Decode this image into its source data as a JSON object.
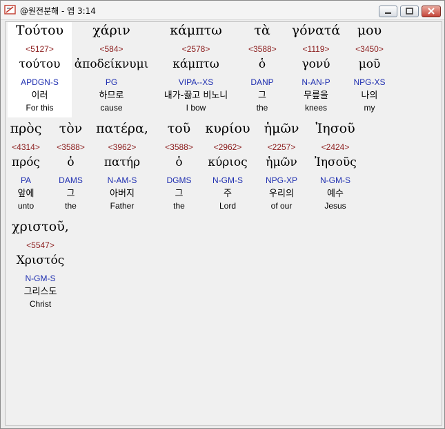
{
  "window": {
    "title": "@원전분해 - 엡 3:14",
    "icon": "bible-app-icon"
  },
  "titlebar_buttons": [
    "minimize",
    "maximize",
    "close"
  ],
  "words": [
    {
      "greek": "Τούτου",
      "strong": "<5127>",
      "lemma": "τούτου",
      "parsing": "APDGN-S",
      "korean": "이러",
      "english": "For this"
    },
    {
      "greek": "χάριν",
      "strong": "<584>",
      "lemma": "ἀποδείκνυμι",
      "parsing": "PG",
      "korean": "하므로",
      "english": "cause"
    },
    {
      "greek": "κάμπτω",
      "strong": "<2578>",
      "lemma": "κάμπτω",
      "parsing": "VIPA--XS",
      "korean": "내가-끓고 비노니",
      "english": "I bow"
    },
    {
      "greek": "τὰ",
      "strong": "<3588>",
      "lemma": "ὁ",
      "parsing": "DANP",
      "korean": "그",
      "english": "the"
    },
    {
      "greek": "γόνατά",
      "strong": "<1119>",
      "lemma": "γονύ",
      "parsing": "N-AN-P",
      "korean": "무릎을",
      "english": "knees"
    },
    {
      "greek": "μου",
      "strong": "<3450>",
      "lemma": "μοῦ",
      "parsing": "NPG-XS",
      "korean": "나의",
      "english": "my"
    },
    {
      "greek": "πρὸς",
      "strong": "<4314>",
      "lemma": "πρός",
      "parsing": "PA",
      "korean": "앞에",
      "english": "unto"
    },
    {
      "greek": "τὸν",
      "strong": "<3588>",
      "lemma": "ὁ",
      "parsing": "DAMS",
      "korean": "그",
      "english": "the"
    },
    {
      "greek": "πατέρα,",
      "strong": "<3962>",
      "lemma": "πατήρ",
      "parsing": "N-AM-S",
      "korean": "아버지",
      "english": "Father"
    },
    {
      "greek": "τοῦ",
      "strong": "<3588>",
      "lemma": "ὁ",
      "parsing": "DGMS",
      "korean": "그",
      "english": "the"
    },
    {
      "greek": "κυρίου",
      "strong": "<2962>",
      "lemma": "κύριος",
      "parsing": "N-GM-S",
      "korean": "주",
      "english": "Lord"
    },
    {
      "greek": "ἡμῶν",
      "strong": "<2257>",
      "lemma": "ἡμῶν",
      "parsing": "NPG-XP",
      "korean": "우리의",
      "english": "of our"
    },
    {
      "greek": "Ἰησοῦ",
      "strong": "<2424>",
      "lemma": "Ἰησοῦς",
      "parsing": "N-GM-S",
      "korean": "예수",
      "english": "Jesus"
    },
    {
      "greek": "χριστοῦ,",
      "strong": "<5547>",
      "lemma": "Χριστός",
      "parsing": "N-GM-S",
      "korean": "그리스도",
      "english": "Christ"
    }
  ],
  "colors": {
    "strong": "#8b1c1c",
    "parsing": "#1f2fb0",
    "selected_bg": "#ffffff",
    "client_bg": "#f0f0f0"
  }
}
